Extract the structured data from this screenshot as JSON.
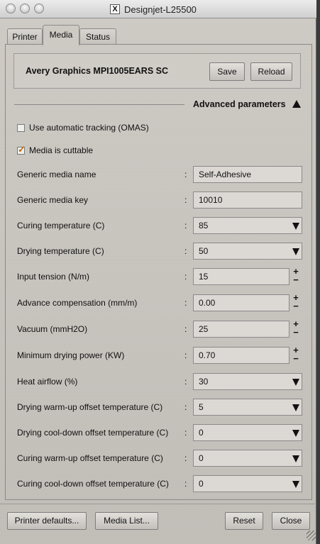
{
  "window": {
    "title": "Designjet-L25500",
    "title_icon": "X"
  },
  "tabs": [
    {
      "label": "Printer",
      "active": false
    },
    {
      "label": "Media",
      "active": true
    },
    {
      "label": "Status",
      "active": false
    }
  ],
  "media": {
    "name": "Avery Graphics MPI1005EARS SC",
    "save_label": "Save",
    "reload_label": "Reload"
  },
  "advanced": {
    "label": "Advanced parameters",
    "expanded": true
  },
  "checkboxes": [
    {
      "label": "Use automatic tracking (OMAS)",
      "checked": false
    },
    {
      "label": "Media is cuttable",
      "checked": true
    }
  ],
  "params": [
    {
      "label": "Generic media name",
      "value": "Self-Adhesive",
      "control": "text"
    },
    {
      "label": "Generic media key",
      "value": "10010",
      "control": "text"
    },
    {
      "label": "Curing temperature (C)",
      "value": "85",
      "control": "select"
    },
    {
      "label": "Drying temperature (C)",
      "value": "50",
      "control": "select"
    },
    {
      "label": "Input tension (N/m)",
      "value": "15",
      "control": "spin"
    },
    {
      "label": "Advance compensation (mm/m)",
      "value": "0.00",
      "control": "spin"
    },
    {
      "label": "Vacuum (mmH2O)",
      "value": "25",
      "control": "spin"
    },
    {
      "label": "Minimum drying power (KW)",
      "value": "0.70",
      "control": "spin"
    },
    {
      "label": "Heat airflow (%)",
      "value": "30",
      "control": "select"
    },
    {
      "label": "Drying warm-up offset temperature (C)",
      "value": "5",
      "control": "select"
    },
    {
      "label": "Drying cool-down offset temperature (C)",
      "value": "0",
      "control": "select"
    },
    {
      "label": "Curing warm-up offset temperature (C)",
      "value": "0",
      "control": "select"
    },
    {
      "label": "Curing cool-down offset temperature (C)",
      "value": "0",
      "control": "select"
    }
  ],
  "separator": ":",
  "spin_symbols": {
    "plus": "+",
    "minus": "−"
  },
  "footer": {
    "printer_defaults_label": "Printer defaults...",
    "media_list_label": "Media List...",
    "reset_label": "Reset",
    "close_label": "Close"
  },
  "colors": {
    "window_bg": "#c9c5bf",
    "check_accent": "#c26a00"
  }
}
